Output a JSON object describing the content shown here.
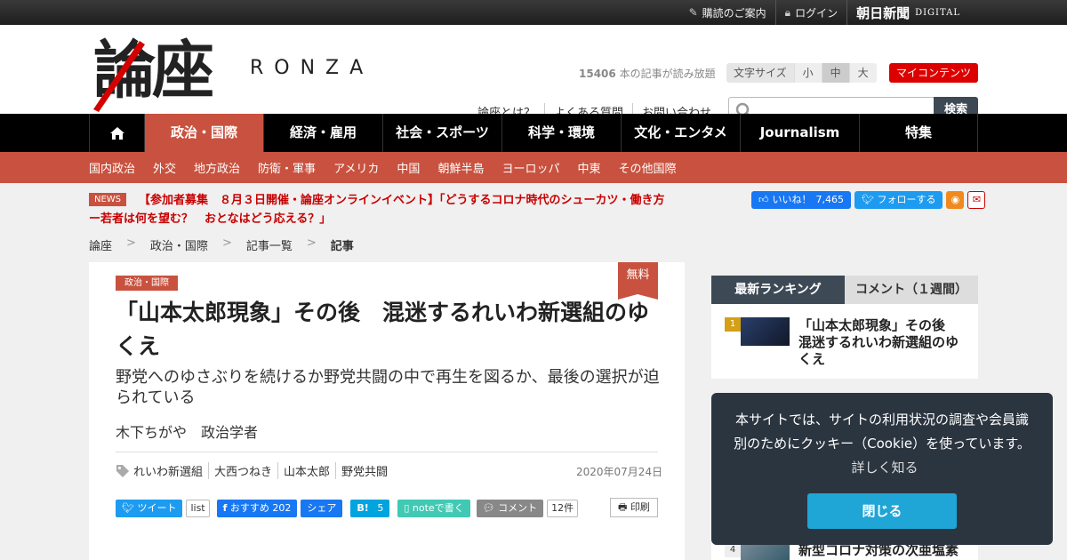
{
  "topbar": {
    "subscribe": "購読のご案内",
    "login": "ログイン",
    "brand": "朝日新聞",
    "brand_sub": "DIGITAL"
  },
  "header": {
    "logo_kanji": "論座",
    "logo_latin": "RONZA",
    "article_count": "15406",
    "article_count_suffix": "本の記事が読み放題",
    "fontsize_label": "文字サイズ",
    "fontsize_options": [
      "小",
      "中",
      "大"
    ],
    "fontsize_selected": "中",
    "mycontents": "マイコンテンツ",
    "links": [
      "論座とは？",
      "よくある質問",
      "お問い合わせ"
    ],
    "search_placeholder": "",
    "search_button": "検索"
  },
  "mainnav": [
    "政治・国際",
    "経済・雇用",
    "社会・スポーツ",
    "科学・環境",
    "文化・エンタメ",
    "Journalism",
    "特集"
  ],
  "mainnav_active": "政治・国際",
  "subnav": [
    "国内政治",
    "外交",
    "地方政治",
    "防衛・軍事",
    "アメリカ",
    "中国",
    "朝鮮半島",
    "ヨーロッパ",
    "中東",
    "その他国際"
  ],
  "news": {
    "badge": "NEWS",
    "text": "【参加者募集　８月３日開催・論座オンラインイベント】「どうするコロナ時代のシューカツ・働き方ー若者は何を望む？　おとなはどう応える？」"
  },
  "social_top": {
    "like": "いいね！",
    "like_count": "7,465",
    "follow": "フォローする"
  },
  "breadcrumb": [
    "論座",
    "政治・国際",
    "記事一覧",
    "記事"
  ],
  "article": {
    "category": "政治・国際",
    "free_badge": "無料",
    "title": "「山本太郎現象」その後　混迷するれいわ新選組のゆくえ",
    "subtitle": "野党へのゆさぶりを続けるか野党共闘の中で再生を図るか、最後の選択が迫られている",
    "author": "木下ちがや　政治学者",
    "tags": [
      "れいわ新選組",
      "大西つねき",
      "山本太郎",
      "野党共闘"
    ],
    "date": "2020年07月24日",
    "share": {
      "tweet": "ツイート",
      "list": "list",
      "recommend": "おすすめ",
      "recommend_count": "202",
      "fb_share": "シェア",
      "hatena": "B!",
      "hatena_count": "5",
      "note": "noteで書く",
      "comment": "コメント",
      "comment_count": "12件",
      "print": "印刷"
    }
  },
  "ranking": {
    "tabs": [
      "最新ランキング",
      "コメント（１週間）"
    ],
    "items": [
      {
        "rank": "1",
        "title": "「山本太郎現象」その後　混迷するれいわ新選組のゆくえ"
      },
      {
        "rank": "4",
        "title": "新型コロナ対策の次亜塩素"
      }
    ]
  },
  "cookie": {
    "message": "本サイトでは、サイトの利用状況の調査や会員識別のためにクッキー（Cookie）を使っています。",
    "more": "詳しく知る",
    "close": "閉じる"
  },
  "colors": {
    "accent": "#c8523f",
    "nav_bg": "#000000",
    "mycontents": "#dd0000",
    "facebook": "#1877f2",
    "twitter": "#1d9bf0",
    "cookie_bg": "#2b3540",
    "cookie_button": "#1fa5d6"
  }
}
